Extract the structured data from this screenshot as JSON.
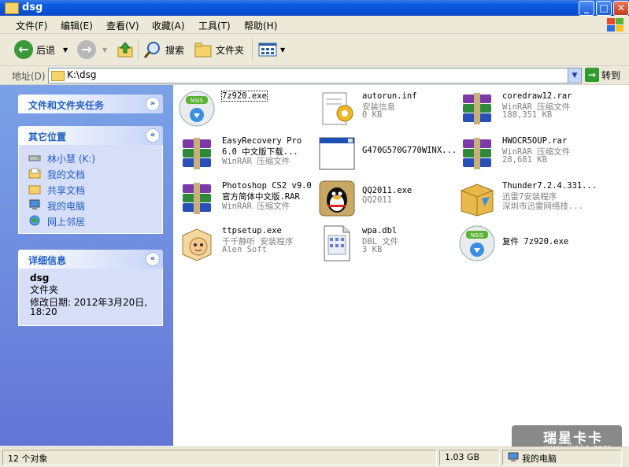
{
  "window": {
    "title": "dsg"
  },
  "titlebar_buttons": {
    "minimize": "_",
    "maximize": "□",
    "close": "✕"
  },
  "menu": {
    "items": [
      "文件(F)",
      "编辑(E)",
      "查看(V)",
      "收藏(A)",
      "工具(T)",
      "帮助(H)"
    ]
  },
  "toolbar": {
    "back_label": "后退",
    "search_label": "搜索",
    "folders_label": "文件夹"
  },
  "address": {
    "label": "地址(D)",
    "path": "K:\\dsg",
    "go_label": "转到"
  },
  "tasks": {
    "file_tasks_title": "文件和文件夹任务",
    "other_places_title": "其它位置",
    "other_places": [
      {
        "label": "林小慧 (K:)",
        "icon": "drive-icon"
      },
      {
        "label": "我的文档",
        "icon": "documents-folder-icon"
      },
      {
        "label": "共享文档",
        "icon": "shared-folder-icon"
      },
      {
        "label": "我的电脑",
        "icon": "computer-icon"
      },
      {
        "label": "网上邻居",
        "icon": "network-icon"
      }
    ],
    "details_title": "详细信息",
    "details": {
      "name": "dsg",
      "type": "文件夹",
      "modified_line1": "修改日期: 2012年3月20日,",
      "modified_line2": "18:20"
    }
  },
  "files": [
    {
      "name": "7z920.exe",
      "line2": "",
      "line3": "",
      "icon": "nsis-installer-icon"
    },
    {
      "name": "autorun.inf",
      "line2": "安装信息",
      "line3": "0 KB",
      "icon": "setup-info-icon"
    },
    {
      "name": "coredraw12.rar",
      "line2": "WinRAR 压缩文件",
      "line3": "188,351 KB",
      "icon": "winrar-icon"
    },
    {
      "name": "EasyRecovery Pro",
      "line2": "6.0 中文版下载...",
      "line3": "WinRAR 压缩文件",
      "icon": "winrar-icon"
    },
    {
      "name": "G470G570G770WINX...",
      "line2": "",
      "line3": "",
      "icon": "window-app-icon"
    },
    {
      "name": "HWOCR5OUP.rar",
      "line2": "WinRAR 压缩文件",
      "line3": "28,681 KB",
      "icon": "winrar-icon"
    },
    {
      "name": "Photoshop CS2 v9.0",
      "line2": "官方简体中文版.RAR",
      "line3": "WinRAR 压缩文件",
      "icon": "winrar-icon"
    },
    {
      "name": "QQ2011.exe",
      "line2": "QQ2011",
      "line3": "",
      "icon": "qq-penguin-icon"
    },
    {
      "name": "Thunder7.2.4.331...",
      "line2": "迅雷7安装程序",
      "line3": "深圳市迅雷网络技...",
      "icon": "thunder-box-icon"
    },
    {
      "name": "ttpsetup.exe",
      "line2": "千千静听 安装程序",
      "line3": "Alen Soft",
      "icon": "ttplayer-box-icon"
    },
    {
      "name": "wpa.dbl",
      "line2": "DBL 文件",
      "line3": "3 KB",
      "icon": "document-icon"
    },
    {
      "name": "复件 7z920.exe",
      "line2": "",
      "line3": "",
      "icon": "nsis-installer-icon"
    }
  ],
  "status": {
    "objects": "12 个对象",
    "size": "1.03 GB",
    "location": "我的电脑"
  },
  "watermark": {
    "main": "瑞星卡卡",
    "url": "www.ikaka.com"
  },
  "colors": {
    "title_blue": "#0a5ce4",
    "task_pane_top": "#7ba2e7",
    "task_pane_bottom": "#6375d6",
    "task_link": "#215dc6"
  }
}
